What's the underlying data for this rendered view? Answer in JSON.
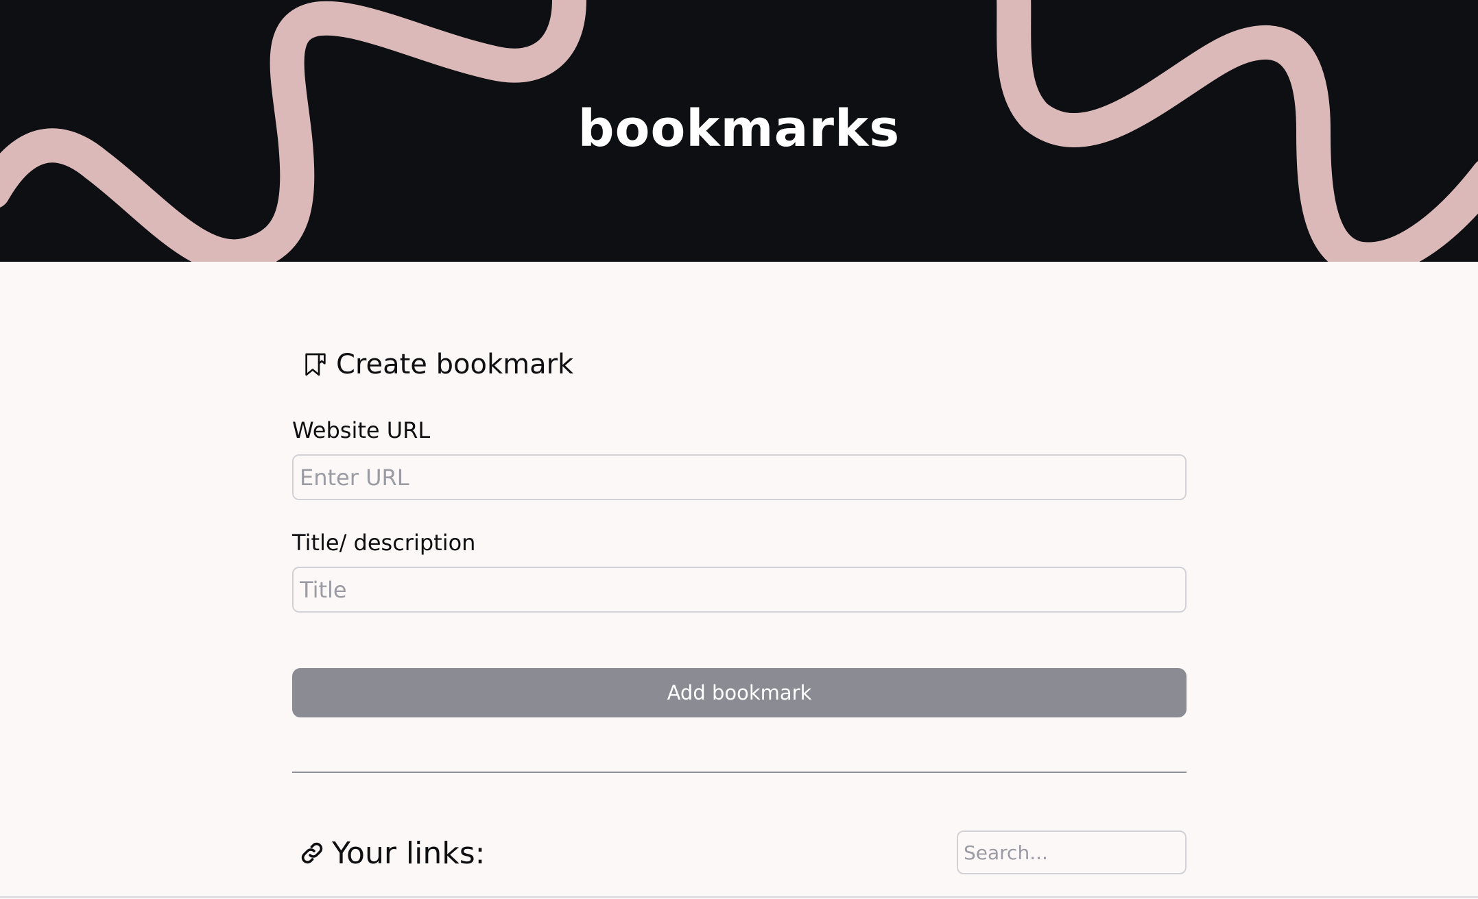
{
  "header": {
    "brand": "bookmarks"
  },
  "create": {
    "title": "Create bookmark",
    "icon": "bookmark-icon",
    "url_label": "Website URL",
    "url_value": "",
    "url_placeholder": "Enter URL",
    "title_label": "Title/ description",
    "title_value": "",
    "title_placeholder": "Title",
    "submit_label": "Add bookmark"
  },
  "links": {
    "title": "Your links:",
    "icon": "link-icon",
    "search_value": "",
    "search_placeholder": "Search..."
  },
  "colors": {
    "hero_background": "#0e0f13",
    "squiggle": "#dbb9b8",
    "page_background": "#fcf8f7",
    "button_background": "#8a8b93",
    "input_border": "#d1d1d6",
    "placeholder": "#9a9ba3"
  }
}
